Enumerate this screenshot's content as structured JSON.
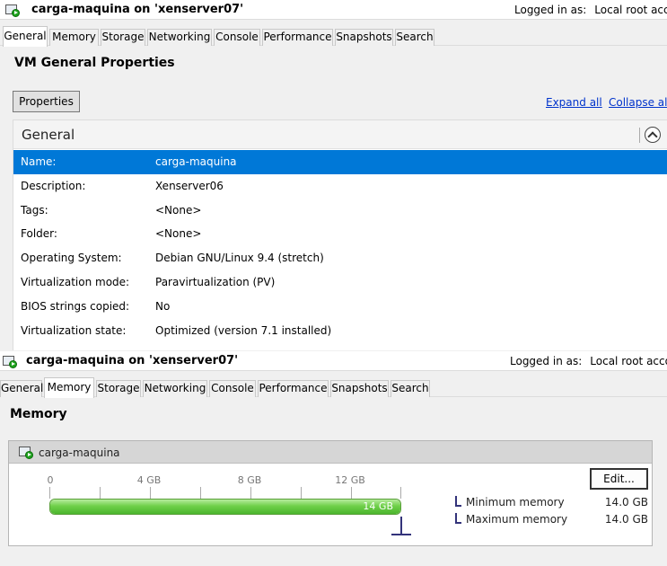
{
  "general_view": {
    "title": "carga-maquina on 'xenserver07'",
    "login_label": "Logged in as:",
    "login_user": "Local root account",
    "tabs": [
      "General",
      "Memory",
      "Storage",
      "Networking",
      "Console",
      "Performance",
      "Snapshots",
      "Search"
    ],
    "active_tab": "General",
    "heading": "VM General Properties",
    "properties_button": "Properties",
    "expand_all": "Expand all",
    "collapse_all": "Collapse all",
    "section_title": "General",
    "rows": [
      {
        "label": "Name:",
        "value": "carga-maquina"
      },
      {
        "label": "Description:",
        "value": "Xenserver06"
      },
      {
        "label": "Tags:",
        "value": "<None>"
      },
      {
        "label": "Folder:",
        "value": "<None>"
      },
      {
        "label": "Operating System:",
        "value": "Debian GNU/Linux 9.4 (stretch)"
      },
      {
        "label": "Virtualization mode:",
        "value": "Paravirtualization (PV)"
      },
      {
        "label": "BIOS strings copied:",
        "value": "No"
      },
      {
        "label": "Virtualization state:",
        "value": "Optimized (version 7.1 installed)"
      }
    ],
    "selected_row": "Name:"
  },
  "memory_view": {
    "title": "carga-maquina on 'xenserver07'",
    "login_label": "Logged in as:",
    "login_user": "Local root account",
    "tabs": [
      "General",
      "Memory",
      "Storage",
      "Networking",
      "Console",
      "Performance",
      "Snapshots",
      "Search"
    ],
    "active_tab": "Memory",
    "heading": "Memory",
    "vm_name": "carga-maquina",
    "edit_button": "Edit...",
    "scale_labels": [
      "0",
      "4 GB",
      "8 GB",
      "12 GB"
    ],
    "bar_label": "14 GB",
    "bar_fill_fraction": 1.0,
    "legend": [
      {
        "label": "Minimum memory",
        "value": "14.0 GB"
      },
      {
        "label": "Maximum memory",
        "value": "14.0 GB"
      }
    ]
  },
  "icons": {
    "vm": "vm-running-icon",
    "collapse": "chevron-up-circle-icon",
    "legend": "bracket-marker-icon"
  },
  "colors": {
    "selection": "#0078d7",
    "link": "#0033cc",
    "memory_bar": "#4bb52d",
    "marker": "#33337a"
  }
}
